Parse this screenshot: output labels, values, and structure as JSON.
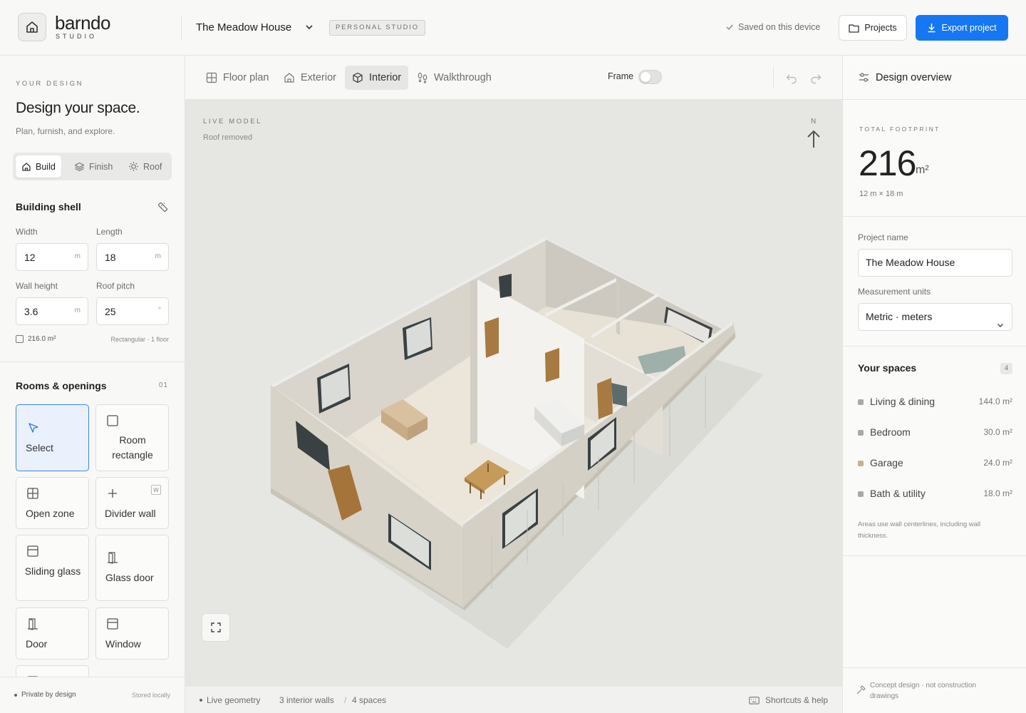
{
  "header": {
    "logo_word": "barndo",
    "logo_sub": "STUDIO",
    "project_title": "The Meadow House",
    "studio_badge": "PERSONAL STUDIO",
    "saved_status": "Saved on this device",
    "projects_label": "Projects",
    "export_label": "Export project"
  },
  "sidebar": {
    "eyebrow": "YOUR DESIGN",
    "title": "Design your space.",
    "subtitle": "Plan, furnish, and explore.",
    "mode_tabs": [
      {
        "label": "Build",
        "icon": "home-icon",
        "active": true
      },
      {
        "label": "Finish",
        "icon": "layers-icon",
        "active": false
      },
      {
        "label": "Roof",
        "icon": "sun-icon",
        "active": false
      }
    ],
    "building_shell": {
      "title": "Building shell",
      "width": {
        "label": "Width",
        "value": "12",
        "unit": "m"
      },
      "length": {
        "label": "Length",
        "value": "18",
        "unit": "m"
      },
      "wall_height": {
        "label": "Wall height",
        "value": "3.6",
        "unit": "m"
      },
      "roof_pitch": {
        "label": "Roof pitch",
        "value": "25",
        "unit": "°"
      },
      "area": "216.0 m²",
      "shape_note": "Rectangular · 1 floor"
    },
    "rooms": {
      "title": "Rooms & openings",
      "count": "01",
      "tools": [
        {
          "label": "Select",
          "icon": "cursor-icon",
          "active": true
        },
        {
          "label": "Room rectangle",
          "icon": "square-icon"
        },
        {
          "label": "Open zone",
          "icon": "grid-icon"
        },
        {
          "label": "Divider wall",
          "icon": "plus-icon",
          "shortcut": "W"
        },
        {
          "label": "Sliding glass",
          "icon": "window-icon"
        },
        {
          "label": "Glass door",
          "icon": "door-icon"
        },
        {
          "label": "Door",
          "icon": "door-icon"
        },
        {
          "label": "Window",
          "icon": "window-icon"
        }
      ]
    },
    "footer": {
      "private": "Private by design",
      "stored": "Stored locally"
    }
  },
  "toolbar": {
    "views": [
      {
        "label": "Floor plan",
        "icon": "grid-icon",
        "active": false
      },
      {
        "label": "Exterior",
        "icon": "home-icon",
        "active": false
      },
      {
        "label": "Interior",
        "icon": "cube-icon",
        "active": true
      },
      {
        "label": "Walkthrough",
        "icon": "footsteps-icon",
        "active": false
      }
    ],
    "frame_label": "Frame",
    "frame_on": false
  },
  "viewport": {
    "eyebrow": "LIVE MODEL",
    "subtitle": "Roof removed",
    "compass": "N"
  },
  "statusbar": {
    "live": "Live geometry",
    "walls": "3 interior walls",
    "separator": "/",
    "spaces": "4 spaces",
    "help": "Shortcuts & help"
  },
  "right_panel": {
    "title": "Design overview",
    "footprint_eyebrow": "TOTAL FOOTPRINT",
    "footprint_value": "216",
    "footprint_unit": "m²",
    "footprint_dims": "12 m × 18 m",
    "project_name_label": "Project name",
    "project_name_value": "The Meadow House",
    "units_label": "Measurement units",
    "units_value": "Metric · meters",
    "spaces_title": "Your spaces",
    "spaces_count": "4",
    "spaces": [
      {
        "name": "Living & dining",
        "area": "144.0 m²",
        "color": "#a9a9a6"
      },
      {
        "name": "Bedroom",
        "area": "30.0 m²",
        "color": "#a9a9a6"
      },
      {
        "name": "Garage",
        "area": "24.0 m²",
        "color": "#c9b08e"
      },
      {
        "name": "Bath & utility",
        "area": "18.0 m²",
        "color": "#a9a9a6"
      }
    ],
    "areas_note": "Areas use wall centerlines, including wall thickness.",
    "footer_note": "Concept design · not construction drawings"
  },
  "colors": {
    "accent": "#1677f2",
    "active_tool_bg": "#eaf1fd",
    "viewport_bg": "#e6e6e2"
  }
}
